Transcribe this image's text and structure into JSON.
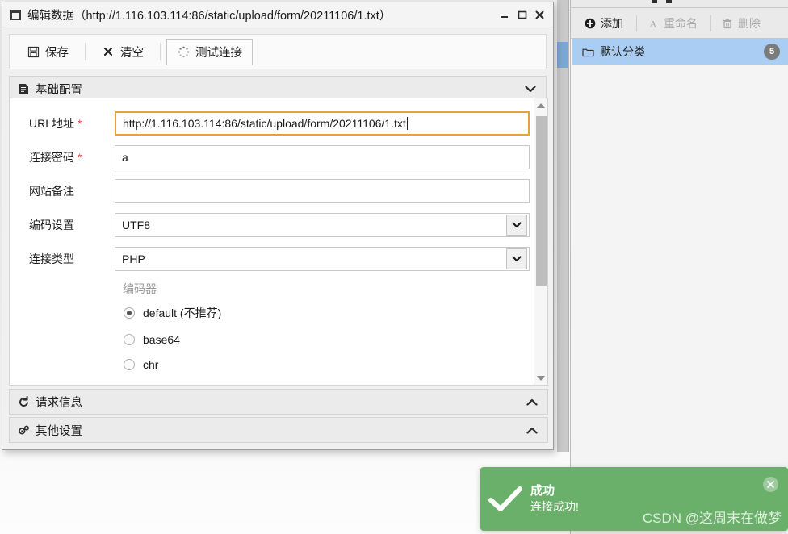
{
  "window": {
    "title": "编辑数据（http://1.116.103.114:86/static/upload/form/20211106/1.txt）",
    "icon": "window-icon",
    "controls": {
      "minimize": "_",
      "maximize": "□",
      "close": "✕"
    }
  },
  "toolbar": {
    "save_label": "保存",
    "clear_label": "清空",
    "test_label": "测试连接"
  },
  "sections": {
    "basic": {
      "title": "基础配置",
      "chevron": "⌄",
      "expanded": true
    },
    "request": {
      "title": "请求信息",
      "chevron": "⌃",
      "expanded": false
    },
    "other": {
      "title": "其他设置",
      "chevron": "⌃",
      "expanded": false
    }
  },
  "form": {
    "fields": [
      {
        "label": "URL地址",
        "required": "*",
        "value": "http://1.116.103.114:86/static/upload/form/20211106/1.txt",
        "type": "text",
        "focused": true
      },
      {
        "label": "连接密码",
        "required": "*",
        "value": "a",
        "type": "text",
        "focused": false
      },
      {
        "label": "网站备注",
        "required": "",
        "value": "",
        "type": "text",
        "focused": false
      },
      {
        "label": "编码设置",
        "required": "",
        "value": "UTF8",
        "type": "select",
        "focused": false
      },
      {
        "label": "连接类型",
        "required": "",
        "value": "PHP",
        "type": "select",
        "focused": false
      }
    ],
    "encoder": {
      "group_label": "编码器",
      "options": [
        {
          "label": "default (不推荐)",
          "selected": true
        },
        {
          "label": "base64",
          "selected": false
        },
        {
          "label": "chr",
          "selected": false
        }
      ]
    }
  },
  "right_panel": {
    "toolbar": {
      "add_label": "添加",
      "rename_label": "重命名",
      "delete_label": "删除"
    },
    "categories": [
      {
        "label": "默认分类",
        "count": "5",
        "selected": true
      }
    ]
  },
  "toast": {
    "title": "成功",
    "message": "连接成功!",
    "close": "✕",
    "watermark": "CSDN @这周末在做梦",
    "color": "#6ab06a"
  },
  "colors": {
    "focus_border": "#e4a33c",
    "selection": "#aacdf3",
    "toast_green": "#6ab06a",
    "badge_gray": "#7b7b7b"
  }
}
